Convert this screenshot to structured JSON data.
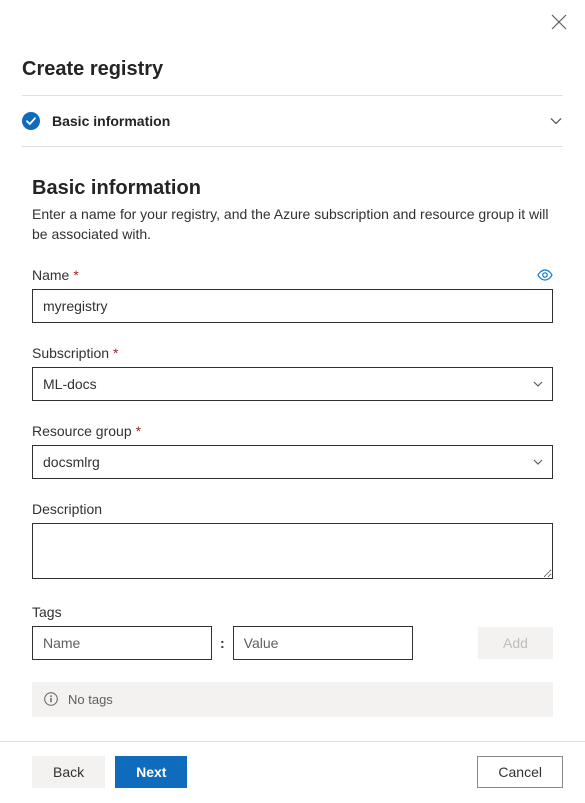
{
  "panel": {
    "title": "Create registry"
  },
  "section": {
    "label": "Basic information"
  },
  "form": {
    "heading": "Basic information",
    "subtext": "Enter a name for your registry, and the Azure subscription and resource group it will be associated with.",
    "name": {
      "label": "Name",
      "required": "*",
      "value": "myregistry"
    },
    "subscription": {
      "label": "Subscription",
      "required": "*",
      "value": "ML-docs"
    },
    "resource_group": {
      "label": "Resource group",
      "required": "*",
      "value": "docsmlrg"
    },
    "description": {
      "label": "Description",
      "value": ""
    },
    "tags": {
      "label": "Tags",
      "name_placeholder": "Name",
      "value_placeholder": "Value",
      "colon": ":",
      "add_label": "Add",
      "empty_text": "No tags"
    }
  },
  "footer": {
    "back": "Back",
    "next": "Next",
    "cancel": "Cancel"
  }
}
